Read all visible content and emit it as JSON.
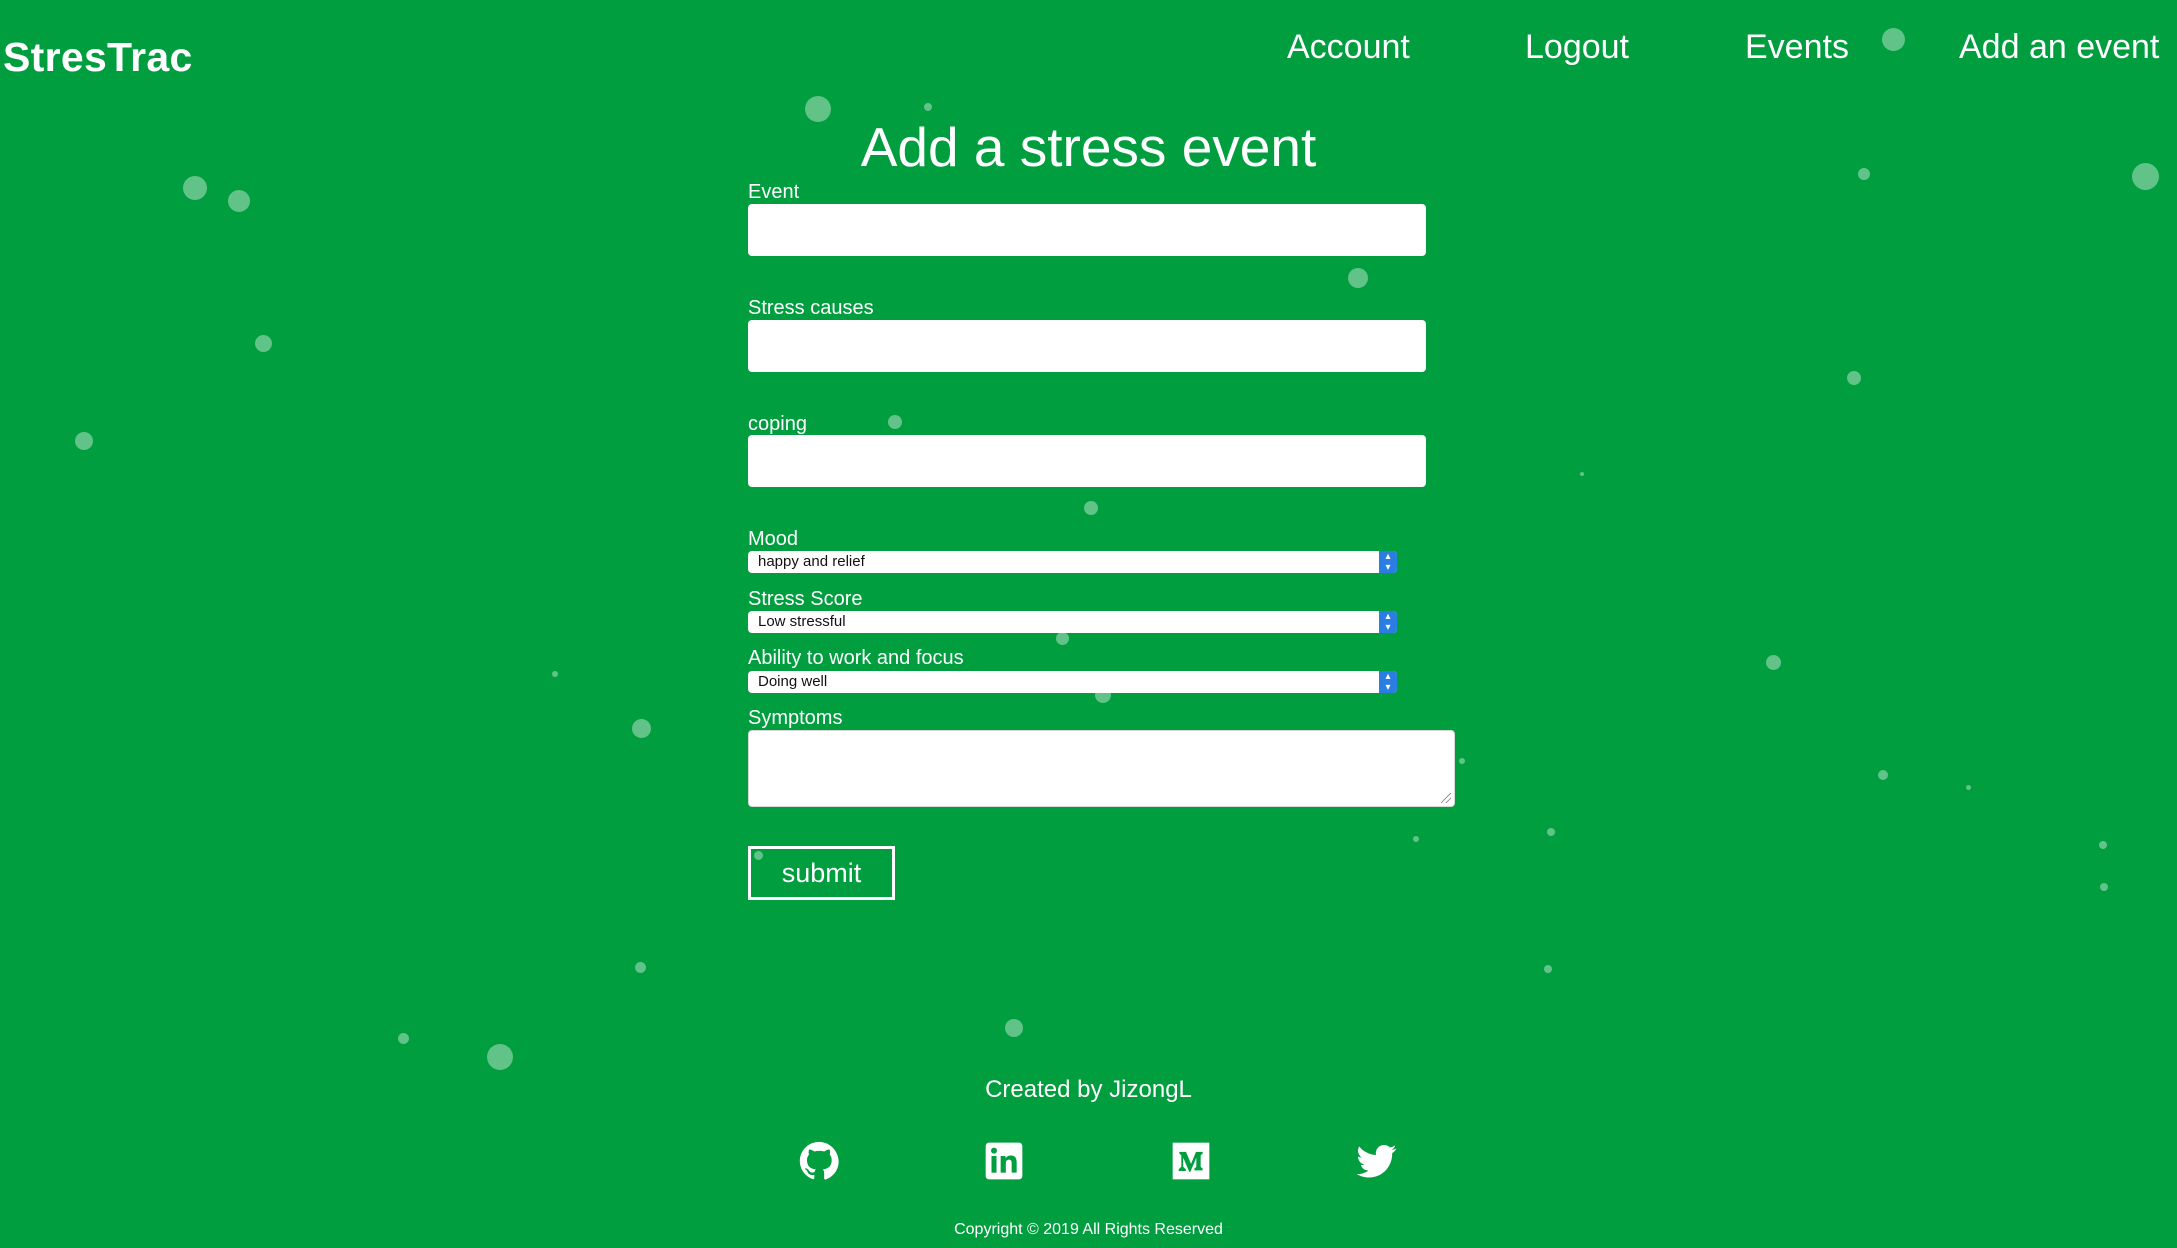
{
  "brand": {
    "name": "StresTrac"
  },
  "nav": {
    "items": [
      {
        "label": "Account"
      },
      {
        "label": "Logout"
      },
      {
        "label": "Events"
      },
      {
        "label": "Add an event"
      }
    ]
  },
  "form": {
    "title": "Add a stress event",
    "event": {
      "label": "Event",
      "value": ""
    },
    "stress_causes": {
      "label": "Stress causes",
      "value": ""
    },
    "coping": {
      "label": "coping",
      "value": ""
    },
    "mood": {
      "label": "Mood",
      "selected": "happy and relief"
    },
    "stress_score": {
      "label": "Stress Score",
      "selected": "Low stressful"
    },
    "ability": {
      "label": "Ability to work and focus",
      "selected": "Doing well"
    },
    "symptoms": {
      "label": "Symptoms",
      "value": ""
    },
    "submit_label": "submit"
  },
  "footer": {
    "credit": "Created by JizongL",
    "social_icons": [
      "github-icon",
      "linkedin-icon",
      "medium-icon",
      "twitter-icon"
    ],
    "copyright": "Copyright © 2019 All Rights Reserved"
  },
  "colors": {
    "background": "#009e3f",
    "text": "#ffffff",
    "select_arrow": "#2a7de1"
  }
}
